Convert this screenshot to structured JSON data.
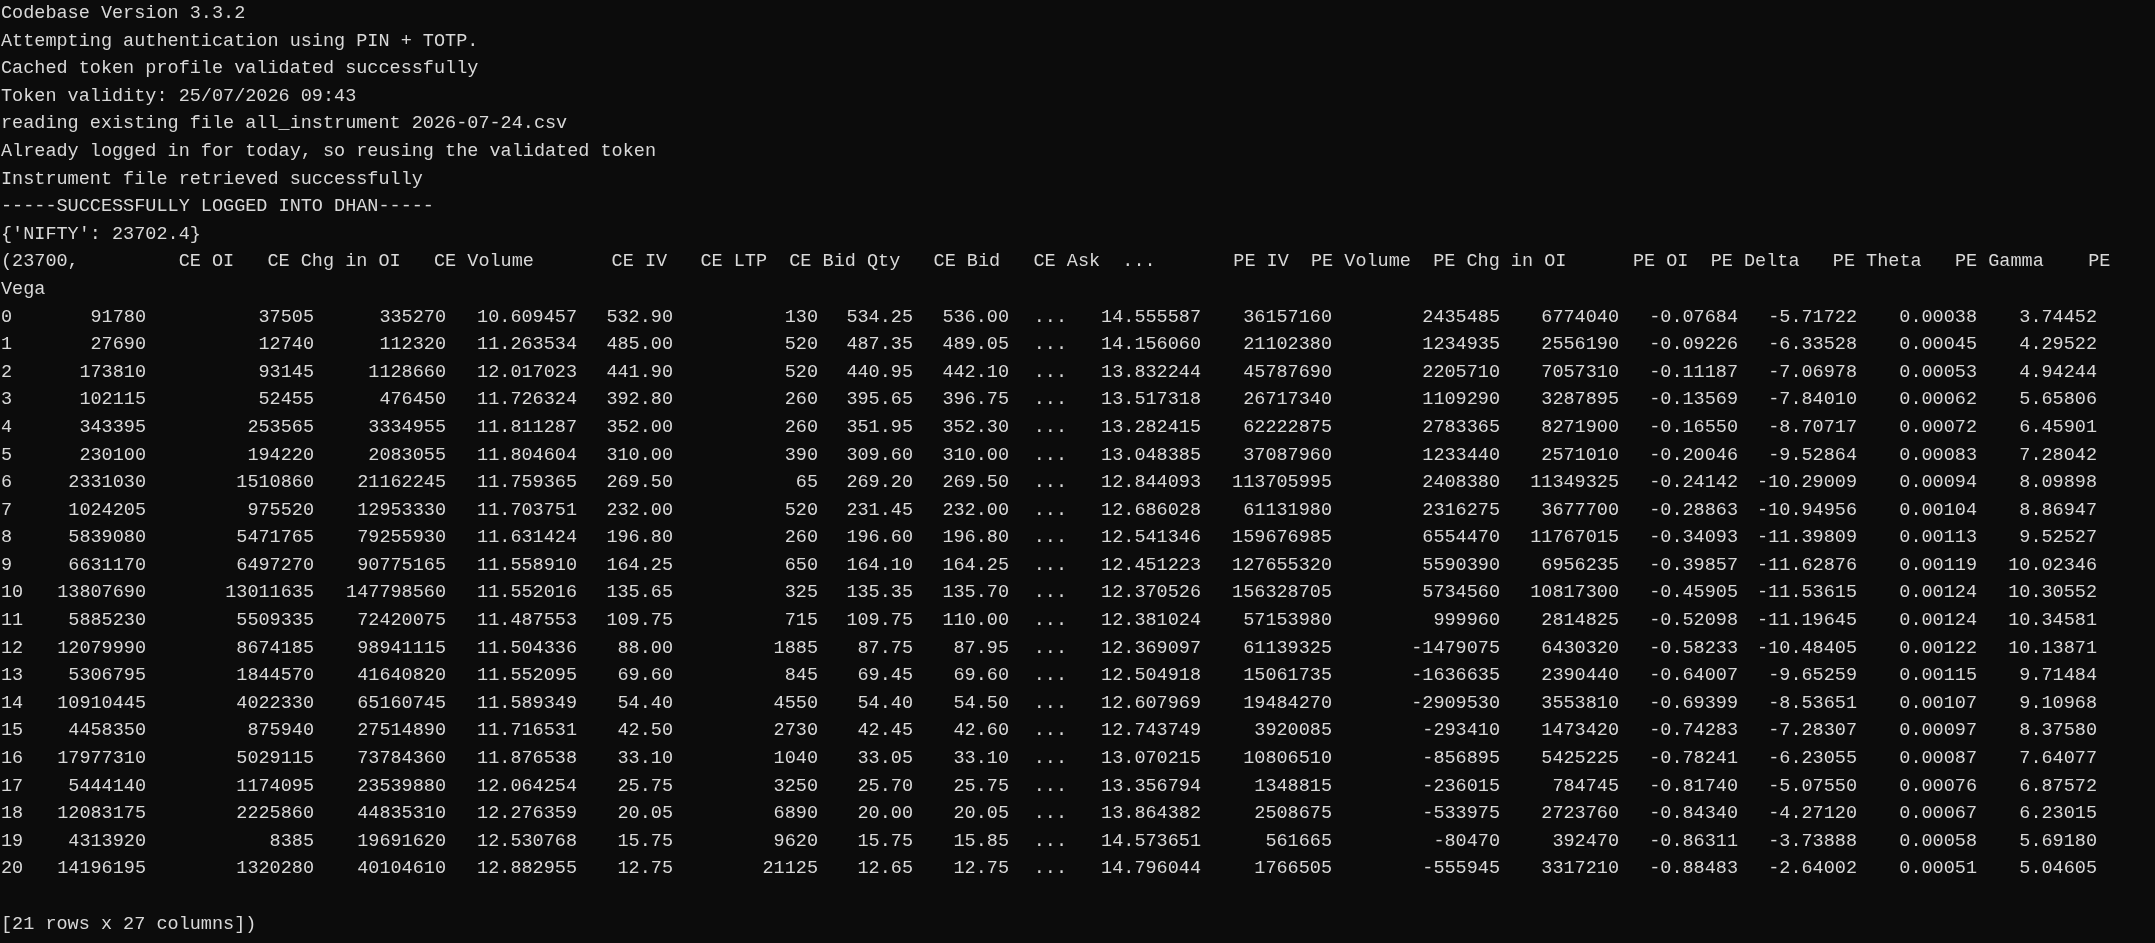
{
  "terminal": {
    "log_lines": [
      "Codebase Version 3.3.2",
      "Attempting authentication using PIN + TOTP.",
      "Cached token profile validated successfully",
      "Token validity: 25/07/2026 09:43",
      "reading existing file all_instrument 2026-07-24.csv",
      "Already logged in for today, so reusing the validated token",
      "Instrument file retrieved successfully",
      "-----SUCCESSFULLY LOGGED INTO DHAN-----",
      "{'NIFTY': 23702.4}"
    ],
    "table_header": "(23700,         CE OI   CE Chg in OI   CE Volume       CE IV   CE LTP  CE Bid Qty   CE Bid   CE Ask  ...       PE IV  PE Volume  PE Chg in OI      PE OI  PE Delta   PE Theta   PE Gamma    PE",
    "table_header_wrap": "Vega",
    "rows": [
      {
        "index": "0",
        "cells": [
          "91780",
          "37505",
          "335270",
          "10.609457",
          "532.90",
          "130",
          "534.25",
          "536.00",
          "...",
          "14.555587",
          "36157160",
          "2435485",
          "6774040",
          "-0.07684",
          "-5.71722",
          "0.00038",
          "3.74452"
        ]
      },
      {
        "index": "1",
        "cells": [
          "27690",
          "12740",
          "112320",
          "11.263534",
          "485.00",
          "520",
          "487.35",
          "489.05",
          "...",
          "14.156060",
          "21102380",
          "1234935",
          "2556190",
          "-0.09226",
          "-6.33528",
          "0.00045",
          "4.29522"
        ]
      },
      {
        "index": "2",
        "cells": [
          "173810",
          "93145",
          "1128660",
          "12.017023",
          "441.90",
          "520",
          "440.95",
          "442.10",
          "...",
          "13.832244",
          "45787690",
          "2205710",
          "7057310",
          "-0.11187",
          "-7.06978",
          "0.00053",
          "4.94244"
        ]
      },
      {
        "index": "3",
        "cells": [
          "102115",
          "52455",
          "476450",
          "11.726324",
          "392.80",
          "260",
          "395.65",
          "396.75",
          "...",
          "13.517318",
          "26717340",
          "1109290",
          "3287895",
          "-0.13569",
          "-7.84010",
          "0.00062",
          "5.65806"
        ]
      },
      {
        "index": "4",
        "cells": [
          "343395",
          "253565",
          "3334955",
          "11.811287",
          "352.00",
          "260",
          "351.95",
          "352.30",
          "...",
          "13.282415",
          "62222875",
          "2783365",
          "8271900",
          "-0.16550",
          "-8.70717",
          "0.00072",
          "6.45901"
        ]
      },
      {
        "index": "5",
        "cells": [
          "230100",
          "194220",
          "2083055",
          "11.804604",
          "310.00",
          "390",
          "309.60",
          "310.00",
          "...",
          "13.048385",
          "37087960",
          "1233440",
          "2571010",
          "-0.20046",
          "-9.52864",
          "0.00083",
          "7.28042"
        ]
      },
      {
        "index": "6",
        "cells": [
          "2331030",
          "1510860",
          "21162245",
          "11.759365",
          "269.50",
          "65",
          "269.20",
          "269.50",
          "...",
          "12.844093",
          "113705995",
          "2408380",
          "11349325",
          "-0.24142",
          "-10.29009",
          "0.00094",
          "8.09898"
        ]
      },
      {
        "index": "7",
        "cells": [
          "1024205",
          "975520",
          "12953330",
          "11.703751",
          "232.00",
          "520",
          "231.45",
          "232.00",
          "...",
          "12.686028",
          "61131980",
          "2316275",
          "3677700",
          "-0.28863",
          "-10.94956",
          "0.00104",
          "8.86947"
        ]
      },
      {
        "index": "8",
        "cells": [
          "5839080",
          "5471765",
          "79255930",
          "11.631424",
          "196.80",
          "260",
          "196.60",
          "196.80",
          "...",
          "12.541346",
          "159676985",
          "6554470",
          "11767015",
          "-0.34093",
          "-11.39809",
          "0.00113",
          "9.52527"
        ]
      },
      {
        "index": "9",
        "cells": [
          "6631170",
          "6497270",
          "90775165",
          "11.558910",
          "164.25",
          "650",
          "164.10",
          "164.25",
          "...",
          "12.451223",
          "127655320",
          "5590390",
          "6956235",
          "-0.39857",
          "-11.62876",
          "0.00119",
          "10.02346"
        ]
      },
      {
        "index": "10",
        "cells": [
          "13807690",
          "13011635",
          "147798560",
          "11.552016",
          "135.65",
          "325",
          "135.35",
          "135.70",
          "...",
          "12.370526",
          "156328705",
          "5734560",
          "10817300",
          "-0.45905",
          "-11.53615",
          "0.00124",
          "10.30552"
        ]
      },
      {
        "index": "11",
        "cells": [
          "5885230",
          "5509335",
          "72420075",
          "11.487553",
          "109.75",
          "715",
          "109.75",
          "110.00",
          "...",
          "12.381024",
          "57153980",
          "999960",
          "2814825",
          "-0.52098",
          "-11.19645",
          "0.00124",
          "10.34581"
        ]
      },
      {
        "index": "12",
        "cells": [
          "12079990",
          "8674185",
          "98941115",
          "11.504336",
          "88.00",
          "1885",
          "87.75",
          "87.95",
          "...",
          "12.369097",
          "61139325",
          "-1479075",
          "6430320",
          "-0.58233",
          "-10.48405",
          "0.00122",
          "10.13871"
        ]
      },
      {
        "index": "13",
        "cells": [
          "5306795",
          "1844570",
          "41640820",
          "11.552095",
          "69.60",
          "845",
          "69.45",
          "69.60",
          "...",
          "12.504918",
          "15061735",
          "-1636635",
          "2390440",
          "-0.64007",
          "-9.65259",
          "0.00115",
          "9.71484"
        ]
      },
      {
        "index": "14",
        "cells": [
          "10910445",
          "4022330",
          "65160745",
          "11.589349",
          "54.40",
          "4550",
          "54.40",
          "54.50",
          "...",
          "12.607969",
          "19484270",
          "-2909530",
          "3553810",
          "-0.69399",
          "-8.53651",
          "0.00107",
          "9.10968"
        ]
      },
      {
        "index": "15",
        "cells": [
          "4458350",
          "875940",
          "27514890",
          "11.716531",
          "42.50",
          "2730",
          "42.45",
          "42.60",
          "...",
          "12.743749",
          "3920085",
          "-293410",
          "1473420",
          "-0.74283",
          "-7.28307",
          "0.00097",
          "8.37580"
        ]
      },
      {
        "index": "16",
        "cells": [
          "17977310",
          "5029115",
          "73784360",
          "11.876538",
          "33.10",
          "1040",
          "33.05",
          "33.10",
          "...",
          "13.070215",
          "10806510",
          "-856895",
          "5425225",
          "-0.78241",
          "-6.23055",
          "0.00087",
          "7.64077"
        ]
      },
      {
        "index": "17",
        "cells": [
          "5444140",
          "1174095",
          "23539880",
          "12.064254",
          "25.75",
          "3250",
          "25.70",
          "25.75",
          "...",
          "13.356794",
          "1348815",
          "-236015",
          "784745",
          "-0.81740",
          "-5.07550",
          "0.00076",
          "6.87572"
        ]
      },
      {
        "index": "18",
        "cells": [
          "12083175",
          "2225860",
          "44835310",
          "12.276359",
          "20.05",
          "6890",
          "20.00",
          "20.05",
          "...",
          "13.864382",
          "2508675",
          "-533975",
          "2723760",
          "-0.84340",
          "-4.27120",
          "0.00067",
          "6.23015"
        ]
      },
      {
        "index": "19",
        "cells": [
          "4313920",
          "8385",
          "19691620",
          "12.530768",
          "15.75",
          "9620",
          "15.75",
          "15.85",
          "...",
          "14.573651",
          "561665",
          "-80470",
          "392470",
          "-0.86311",
          "-3.73888",
          "0.00058",
          "5.69180"
        ]
      },
      {
        "index": "20",
        "cells": [
          "14196195",
          "1320280",
          "40104610",
          "12.882955",
          "12.75",
          "21125",
          "12.65",
          "12.75",
          "...",
          "14.796044",
          "1766505",
          "-555945",
          "3317210",
          "-0.88483",
          "-2.64002",
          "0.00051",
          "5.04605"
        ]
      }
    ],
    "footer": "[21 rows x 27 columns])"
  }
}
